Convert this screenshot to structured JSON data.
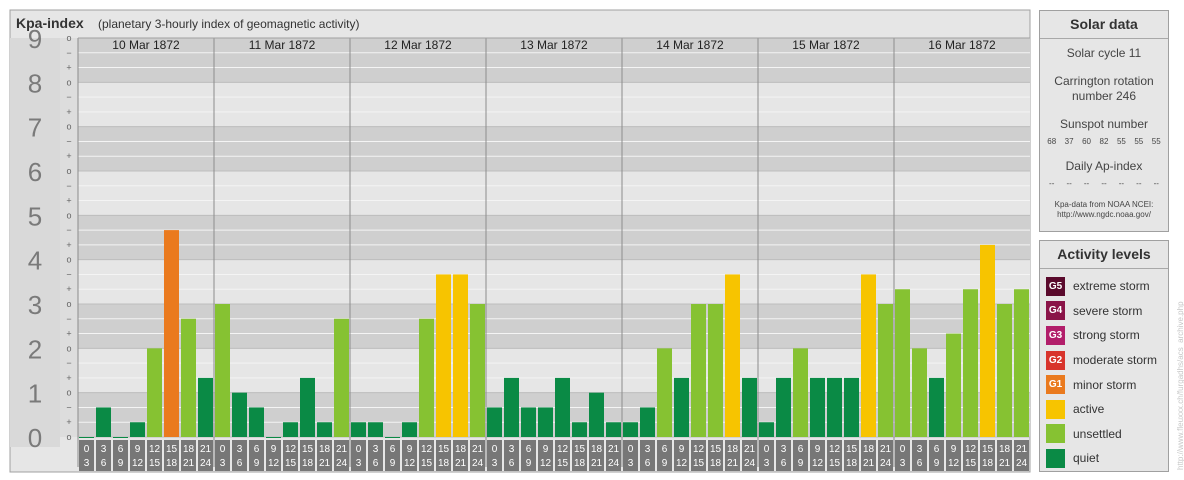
{
  "header": {
    "title": "Kpa-index",
    "subtitle": "(planetary 3-hourly index of geomagnetic activity)"
  },
  "chart_data": {
    "type": "bar",
    "title": "Kpa-index",
    "subtitle": "(planetary 3-hourly index of geomagnetic activity)",
    "ylim": [
      0,
      9
    ],
    "y_ticks": [
      0,
      1,
      2,
      3,
      4,
      5,
      6,
      7,
      8,
      9
    ],
    "y_minor_labels": [
      "o",
      "+",
      "−"
    ],
    "days": [
      "10 Mar 1872",
      "11 Mar 1872",
      "12 Mar 1872",
      "13 Mar 1872",
      "14 Mar 1872",
      "15 Mar 1872",
      "16 Mar 1872"
    ],
    "interval_top": [
      "0",
      "3",
      "6",
      "9",
      "12",
      "15",
      "18",
      "21"
    ],
    "interval_bottom": [
      "3",
      "6",
      "9",
      "12",
      "15",
      "18",
      "21",
      "24"
    ],
    "values": [
      [
        0.0,
        0.667,
        0.0,
        0.333,
        2.0,
        4.667,
        2.667,
        1.333
      ],
      [
        3.0,
        1.0,
        0.667,
        0.0,
        0.333,
        1.333,
        0.333,
        2.667
      ],
      [
        0.333,
        0.333,
        0.0,
        0.333,
        2.667,
        3.667,
        3.667,
        3.0
      ],
      [
        0.667,
        1.333,
        0.667,
        0.667,
        1.333,
        0.333,
        1.0,
        0.333
      ],
      [
        0.333,
        0.667,
        2.0,
        1.333,
        3.0,
        3.0,
        3.667,
        1.333
      ],
      [
        0.333,
        1.333,
        2.0,
        1.333,
        1.333,
        1.333,
        3.667,
        3.0
      ],
      [
        3.333,
        2.0,
        1.333,
        2.333,
        3.333,
        4.333,
        3.0,
        3.333
      ]
    ],
    "colors": {
      "quiet": "#0a8a45",
      "unsettled": "#86c232",
      "active": "#f7c400",
      "minor_storm": "#ea7a1e"
    }
  },
  "solar": {
    "title": "Solar data",
    "cycle": "Solar cycle 11",
    "rotation_line1": "Carrington rotation",
    "rotation_line2": "number 246",
    "sunspot_title": "Sunspot number",
    "sunspots": [
      "68",
      "37",
      "60",
      "82",
      "55",
      "55",
      "55"
    ],
    "ap_title": "Daily Ap-index",
    "ap": [
      "--",
      "--",
      "--",
      "--",
      "--",
      "--",
      "--"
    ],
    "source_line1": "Kpa-data from NOAA NCEI:",
    "source_line2": "http://www.ngdc.noaa.gov/"
  },
  "activity": {
    "title": "Activity levels",
    "levels": [
      {
        "badge": "G5",
        "label": "extreme storm",
        "color": "#5a0a2c"
      },
      {
        "badge": "G4",
        "label": "severe storm",
        "color": "#8a1448"
      },
      {
        "badge": "G3",
        "label": "strong storm",
        "color": "#b21e6a"
      },
      {
        "badge": "G2",
        "label": "moderate storm",
        "color": "#d8342c"
      },
      {
        "badge": "G1",
        "label": "minor storm",
        "color": "#ea7a1e"
      },
      {
        "badge": "",
        "label": "active",
        "color": "#f7c400"
      },
      {
        "badge": "",
        "label": "unsettled",
        "color": "#86c232"
      },
      {
        "badge": "",
        "label": "quiet",
        "color": "#0a8a45"
      }
    ]
  },
  "watermark": "http://www.fleuxxx.ch/furgadhs/acs_archive.php"
}
